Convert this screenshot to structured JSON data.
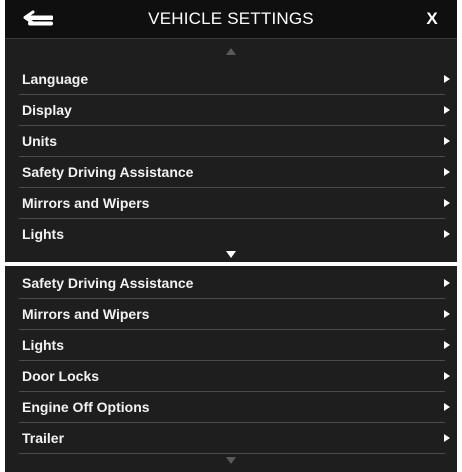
{
  "header": {
    "title": "VEHICLE SETTINGS",
    "close_label": "X",
    "back_icon": "back-arrow-icon"
  },
  "screen_top": {
    "scroll_up_icon": "scroll-up-arrow-icon",
    "scroll_down_icon": "scroll-down-arrow-icon",
    "items": [
      {
        "label": "Language"
      },
      {
        "label": "Display"
      },
      {
        "label": "Units"
      },
      {
        "label": "Safety Driving Assistance"
      },
      {
        "label": "Mirrors and Wipers"
      },
      {
        "label": "Lights"
      }
    ]
  },
  "screen_bottom": {
    "scroll_down_icon": "scroll-down-arrow-icon",
    "items": [
      {
        "label": "Safety Driving Assistance"
      },
      {
        "label": "Mirrors and Wipers"
      },
      {
        "label": "Lights"
      },
      {
        "label": "Door Locks"
      },
      {
        "label": "Engine Off Options"
      },
      {
        "label": "Trailer"
      }
    ]
  },
  "colors": {
    "background": "#1e1e1f",
    "header": "#0f0f10",
    "text": "#f2f2f2",
    "separator": "#4b4b4d",
    "scroll_arrow_active": "#ffffff",
    "scroll_arrow_dim": "#5a5a5c"
  }
}
